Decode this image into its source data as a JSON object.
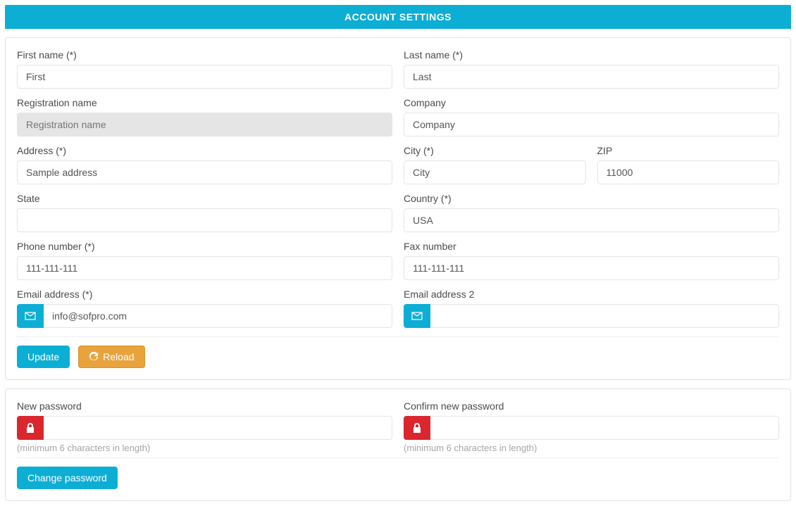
{
  "header": {
    "title": "ACCOUNT SETTINGS"
  },
  "labels": {
    "first_name": "First name (*)",
    "last_name": "Last name (*)",
    "registration_name": "Registration name",
    "company": "Company",
    "address": "Address (*)",
    "city": "City (*)",
    "zip": "ZIP",
    "state": "State",
    "country": "Country (*)",
    "phone": "Phone number (*)",
    "fax": "Fax number",
    "email": "Email address (*)",
    "email2": "Email address 2",
    "new_password": "New password",
    "confirm_password": "Confirm new password"
  },
  "placeholders": {
    "registration_name": "Registration name"
  },
  "values": {
    "first_name": "First",
    "last_name": "Last",
    "registration_name": "",
    "company": "Company",
    "address": "Sample address",
    "city": "City",
    "zip": "11000",
    "state": "",
    "country": "USA",
    "phone": "111-111-111",
    "fax": "111-111-111",
    "email": "info@sofpro.com",
    "email2": "",
    "new_password": "",
    "confirm_password": ""
  },
  "help": {
    "pw_hint": "(minimum 6 characters in length)"
  },
  "buttons": {
    "update": "Update",
    "reload": "Reload",
    "change_password": "Change password"
  }
}
